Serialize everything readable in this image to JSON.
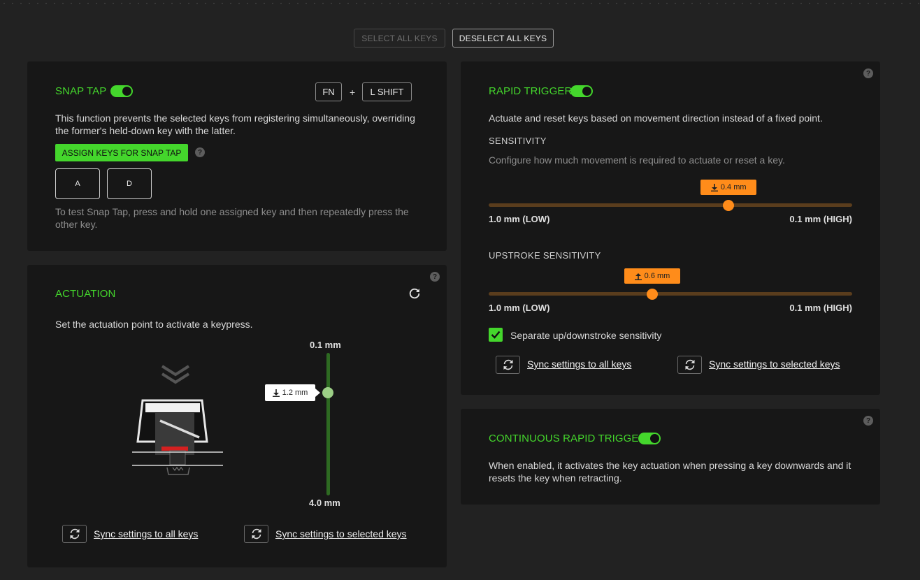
{
  "top_bar": {
    "select_all_label": "SELECT ALL KEYS",
    "deselect_all_label": "DESELECT ALL KEYS"
  },
  "snap_tap": {
    "title": "SNAP TAP",
    "enabled": true,
    "shortcut_key_1": "FN",
    "shortcut_plus": "+",
    "shortcut_key_2": "L SHIFT",
    "description_line1": "This function prevents the selected keys from registering simultaneously, overriding",
    "description_line2": "the former's held-down key with the latter.",
    "assign_button_label": "ASSIGN KEYS FOR SNAP TAP",
    "help_label": "?",
    "assigned_keys": [
      "A",
      "D"
    ],
    "test_hint_line1": "To test Snap Tap, press and hold one assigned key and then repeatedly press the",
    "test_hint_line2": "other key."
  },
  "actuation": {
    "title": "ACTUATION",
    "help_label": "?",
    "description": "Set the actuation point to activate a keypress.",
    "top_label": "0.1 mm",
    "bottom_label": "4.0 mm",
    "current_value": "1.2 mm",
    "current_fraction": 0.28,
    "sync_all_label": "Sync settings to all keys",
    "sync_selected_label": "Sync settings to selected keys"
  },
  "rapid_trigger": {
    "title": "RAPID TRIGGER",
    "enabled": true,
    "help_label": "?",
    "description": "Actuate and reset keys based on movement direction instead of a fixed point.",
    "sensitivity_heading": "SENSITIVITY",
    "sensitivity_description": "Configure how much movement is required to actuate or reset a key.",
    "sensitivity_value": "0.4 mm",
    "sensitivity_fraction": 0.66,
    "low_label": "1.0 mm (LOW)",
    "high_label": "0.1 mm (HIGH)",
    "upstroke_heading": "UPSTROKE SENSITIVITY",
    "upstroke_value": "0.6 mm",
    "upstroke_fraction": 0.45,
    "upstroke_low_label": "1.0 mm (LOW)",
    "upstroke_high_label": "0.1 mm (HIGH)",
    "separate_checkbox_label": "Separate up/downstroke sensitivity",
    "separate_checked": true,
    "sync_all_label": "Sync settings to all keys",
    "sync_selected_label": "Sync settings to selected keys"
  },
  "continuous_rapid_trigger": {
    "title": "CONTINUOUS RAPID TRIGGER",
    "enabled": true,
    "help_label": "?",
    "description_line1": "When enabled, it activates the key actuation when pressing a key downwards and it",
    "description_line2": "resets the key when retracting."
  },
  "colors": {
    "accent_green": "#44d62c",
    "accent_orange": "#ff8c1a",
    "panel_bg": "#171717",
    "page_bg": "#222222"
  },
  "icons": [
    "sync-icon",
    "reset-icon",
    "help-icon",
    "arrow-down-icon",
    "arrow-up-icon",
    "checkmark-icon",
    "chevron-down-icon",
    "switch-illustration"
  ]
}
